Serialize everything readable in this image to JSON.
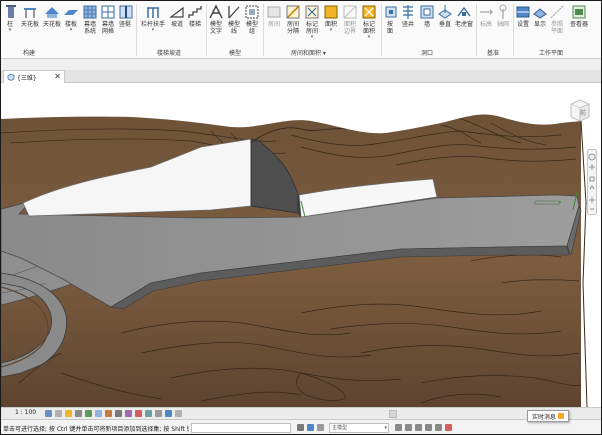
{
  "ribbon": {
    "tools": [
      {
        "key": "column",
        "label": "柱",
        "dd": "▾",
        "color": "#6a7fa8"
      },
      {
        "key": "ceiling",
        "label": "天花板",
        "color": "#4f86c6"
      },
      {
        "key": "floor",
        "label": "楼板",
        "dd": "▾",
        "color": "#4f86c6"
      },
      {
        "key": "roof",
        "label": "屋顶",
        "dd": "▾",
        "color": "#4f86c6"
      },
      {
        "key": "curtain_system",
        "label": "幕墙\n系统",
        "color": "#4f86c6"
      },
      {
        "key": "curtain_grid",
        "label": "幕墙\n网格",
        "color": "#4f86c6"
      },
      {
        "key": "mullion",
        "label": "竖梃",
        "color": "#4f86c6"
      },
      {
        "key": "railing",
        "label": "栏杆扶手",
        "dd": "▾",
        "color": "#4f86c6"
      },
      {
        "key": "ramp",
        "label": "坡道",
        "color": "#555555"
      },
      {
        "key": "stair",
        "label": "楼梯",
        "color": "#555555"
      },
      {
        "key": "model_text",
        "label": "模型\n文字",
        "color": "#555555"
      },
      {
        "key": "model_line",
        "label": "模型\n线",
        "color": "#555555"
      },
      {
        "key": "model_group",
        "label": "模型\n组",
        "color": "#555555"
      },
      {
        "key": "room",
        "label": "房间",
        "color": "#9a9a9a"
      },
      {
        "key": "room_separator",
        "label": "房间\n分隔",
        "color": "#f0b429"
      },
      {
        "key": "tag_room",
        "label": "标记\n房间",
        "dd": "▾",
        "color": "#f0b429"
      },
      {
        "key": "area",
        "label": "面积",
        "dd": "▾",
        "color": "#f0b429"
      },
      {
        "key": "area_boundary",
        "label": "面积\n边界",
        "color": "#9a9a9a"
      },
      {
        "key": "tag_area",
        "label": "标记\n面积",
        "dd": "▾",
        "color": "#f0b429"
      },
      {
        "key": "by_face",
        "label": "按\n面",
        "color": "#4f86c6"
      },
      {
        "key": "shaft",
        "label": "竖井",
        "color": "#4f86c6"
      },
      {
        "key": "wall_opening",
        "label": "墙",
        "color": "#4f86c6"
      },
      {
        "key": "vertical",
        "label": "垂直",
        "color": "#4f86c6"
      },
      {
        "key": "dormer",
        "label": "老虎窗",
        "color": "#4f86c6"
      },
      {
        "key": "level",
        "label": "标高",
        "color": "#9a9a9a"
      },
      {
        "key": "grid",
        "label": "轴网",
        "color": "#9a9a9a"
      },
      {
        "key": "set",
        "label": "设置",
        "color": "#4f86c6"
      },
      {
        "key": "show",
        "label": "显示",
        "color": "#4f86c6"
      },
      {
        "key": "ref_plane",
        "label": "参照\n平面",
        "color": "#9a9a9a"
      },
      {
        "key": "viewer",
        "label": "查看器",
        "color": "#4f8a4f"
      }
    ],
    "panels": {
      "build": "构建",
      "circulation": "楼梯坡道",
      "model": "模型",
      "room_area": "房间和面积 ▾",
      "opening": "洞口",
      "datum": "基准",
      "work_plane": "工作平面"
    }
  },
  "tab": {
    "label": "{三维}",
    "close": "✕",
    "active": true
  },
  "viewcube": {
    "face_label": "前"
  },
  "viewbar": {
    "scale": "1 : 100"
  },
  "statusbar": {
    "message": "单击可进行选择; 按 Ctrl 键并单击可将新项目添加到选择集; 按 Shift 键并单击可",
    "model_select": "主模型",
    "realtime_tooltip": "实时消息"
  },
  "colors": {
    "terrain": "#7a5a3e",
    "terrain_dark": "#4a3422",
    "building_top": "#8e8e8e",
    "building_wall": "#f3f3f3",
    "accent_blue": "#4f86c6"
  }
}
